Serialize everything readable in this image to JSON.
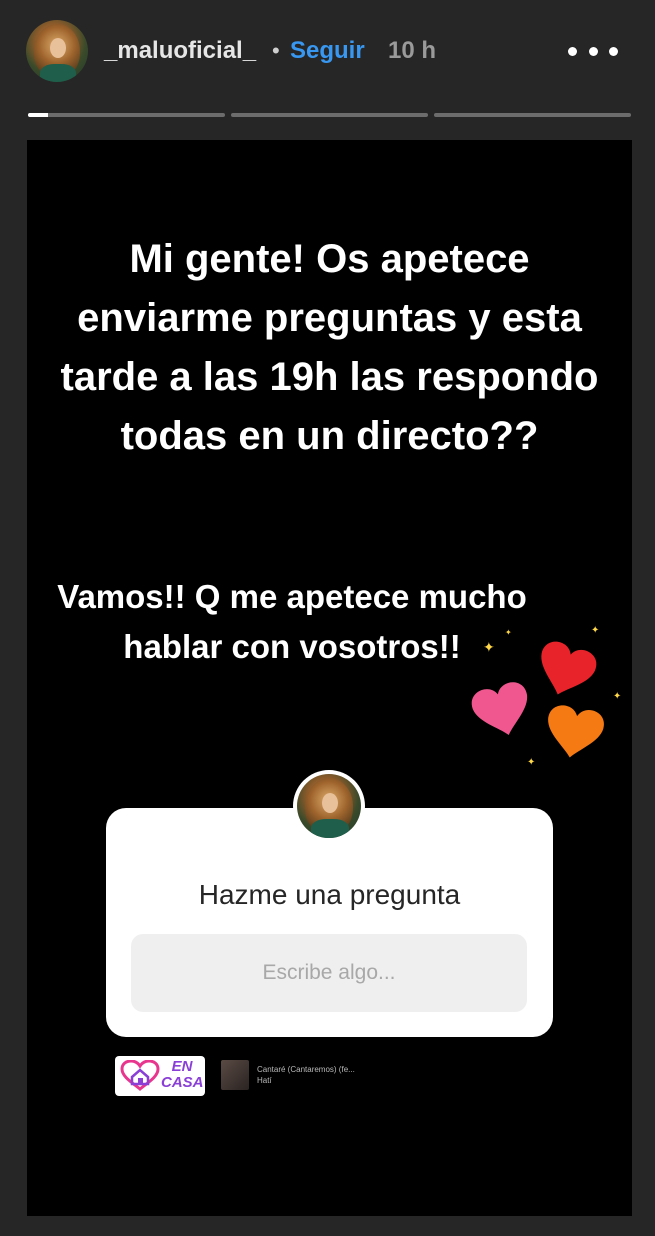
{
  "header": {
    "username": "_maluoficial_",
    "separator": "•",
    "follow_label": "Seguir",
    "time_ago": "10 h",
    "more_icon": "more-horizontal-icon"
  },
  "progress": {
    "segments": 3,
    "current_segment_progress": 0.1
  },
  "story": {
    "main_text": "Mi gente! Os apetece enviarme preguntas y esta tarde a las 19h las respondo todas en un directo??",
    "sub_text": "Vamos!! Q me apetece mucho hablar con vosotros!!",
    "hearts_colors": [
      "#e8232a",
      "#f0578f",
      "#f57a14"
    ],
    "question_sticker": {
      "title": "Hazme una pregunta",
      "input_placeholder": "Escribe algo..."
    },
    "encasa_sticker": {
      "line1": "EN",
      "line2": "CASA"
    },
    "music_sticker": {
      "title": "Cantaré (Cantaremos) (fe...",
      "artist": "Hatí"
    }
  },
  "colors": {
    "background": "#262626",
    "story_background": "#000000",
    "follow_blue": "#3897f0",
    "encasa_purple": "#8a3fd6"
  }
}
